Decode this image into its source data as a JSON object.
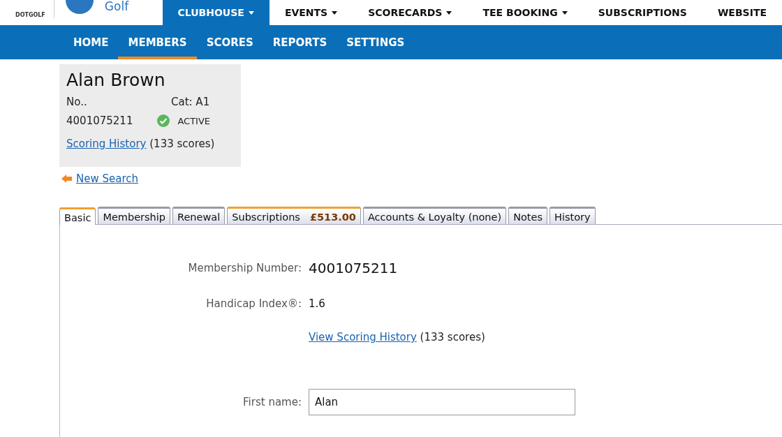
{
  "brand": {
    "logo_text": "DOTGOLF",
    "name": "Golf"
  },
  "top_nav": [
    {
      "label": "CLUBHOUSE",
      "selected": true,
      "dropdown": true
    },
    {
      "label": "EVENTS",
      "selected": false,
      "dropdown": true
    },
    {
      "label": "SCORECARDS",
      "selected": false,
      "dropdown": true
    },
    {
      "label": "TEE BOOKING",
      "selected": false,
      "dropdown": true
    },
    {
      "label": "SUBSCRIPTIONS",
      "selected": false,
      "dropdown": false
    },
    {
      "label": "WEBSITE",
      "selected": false,
      "dropdown": false
    }
  ],
  "sub_nav": [
    {
      "label": "HOME",
      "selected": false
    },
    {
      "label": "MEMBERS",
      "selected": true
    },
    {
      "label": "SCORES",
      "selected": false
    },
    {
      "label": "REPORTS",
      "selected": false
    },
    {
      "label": "SETTINGS",
      "selected": false
    }
  ],
  "member": {
    "name": "Alan Brown",
    "number_label": "No..",
    "category": "Cat: A1",
    "number": "4001075211",
    "status": "ACTIVE",
    "history_link": "Scoring History",
    "history_count": "(133 scores)"
  },
  "back_link": "New Search",
  "tabs": [
    {
      "label": "Basic",
      "selected": true,
      "highlighted": false
    },
    {
      "label": "Membership",
      "selected": false,
      "highlighted": false
    },
    {
      "label": "Renewal",
      "selected": false,
      "highlighted": false
    },
    {
      "label": "Subscriptions",
      "amount": "£513.00",
      "selected": false,
      "highlighted": true
    },
    {
      "label": "Accounts & Loyalty (none)",
      "selected": false,
      "highlighted": false
    },
    {
      "label": "Notes",
      "selected": false,
      "highlighted": false
    },
    {
      "label": "History",
      "selected": false,
      "highlighted": false
    }
  ],
  "fields": [
    {
      "kind": "big",
      "label": "Membership Number:",
      "value": "4001075211"
    },
    {
      "kind": "text",
      "label": "Handicap Index®:",
      "value": "1.6"
    },
    {
      "kind": "link",
      "link": "View Scoring History",
      "value": "(133 scores)"
    },
    {
      "kind": "input",
      "label": "First name:",
      "value": "Alan"
    }
  ]
}
